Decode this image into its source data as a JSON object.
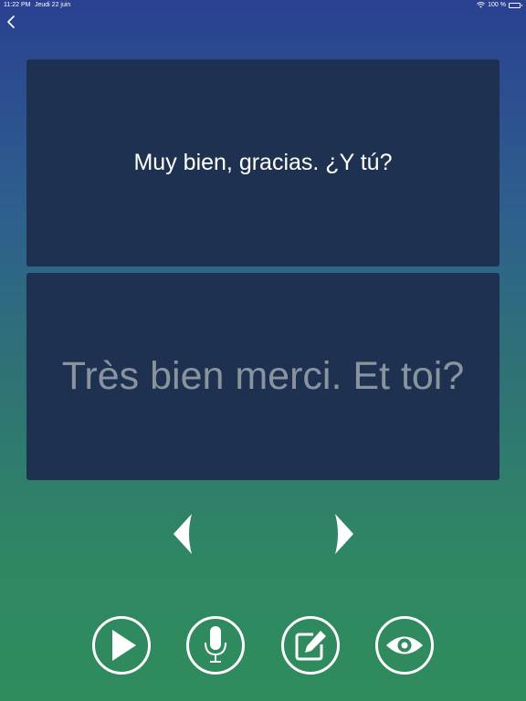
{
  "status_bar": {
    "time": "11:22 PM",
    "date": "Jeudi 22 juin",
    "battery": "100 %",
    "wifi_icon": "wifi-icon",
    "battery_icon": "battery-icon"
  },
  "nav": {
    "back_icon": "chevron-left-icon"
  },
  "cards": {
    "spanish": "Muy bien, gracias. ¿Y tú?",
    "french": "Très bien merci. Et toi?"
  },
  "controls": {
    "prev_icon": "triangle-left-icon",
    "next_icon": "triangle-right-icon",
    "play_icon": "play-icon",
    "mic_icon": "microphone-icon",
    "edit_icon": "edit-icon",
    "eye_icon": "eye-icon"
  },
  "colors": {
    "gradient_top": "#2a4191",
    "gradient_bottom": "#2f8c5c",
    "card_bg": "#1e3150",
    "french_text": "#8a949e",
    "foreground": "#ffffff"
  }
}
